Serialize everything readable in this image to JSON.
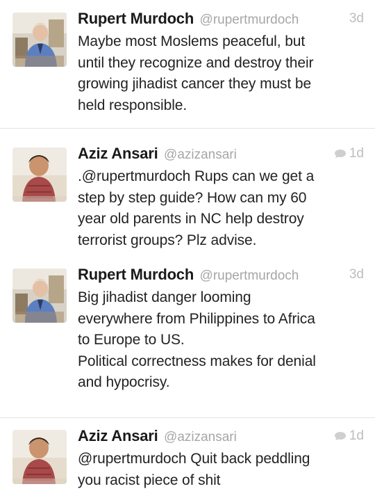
{
  "tweets": [
    {
      "name": "Rupert Murdoch",
      "handle": "@rupertmurdoch",
      "time": "3d",
      "has_reply_icon": false,
      "text": "Maybe most Moslems peaceful, but\nuntil they recognize and destroy their\ngrowing jihadist cancer they must be\nheld responsible.",
      "avatar": "rupert-murdoch-avatar"
    },
    {
      "name": "Aziz Ansari",
      "handle": "@azizansari",
      "time": "1d",
      "has_reply_icon": true,
      "text": ".@rupertmurdoch Rups can we get a\nstep by step guide? How can my 60\nyear old parents in NC help destroy\nterrorist groups? Plz advise.",
      "avatar": "aziz-ansari-avatar"
    },
    {
      "name": "Rupert Murdoch",
      "handle": "@rupertmurdoch",
      "time": "3d",
      "has_reply_icon": false,
      "text": "Big jihadist danger looming\neverywhere from Philippines to Africa\nto Europe to US.\nPolitical correctness makes for denial\nand hypocrisy.",
      "avatar": "rupert-murdoch-avatar"
    },
    {
      "name": "Aziz Ansari",
      "handle": "@azizansari",
      "time": "1d",
      "has_reply_icon": true,
      "text": "@rupertmurdoch Quit back peddling\nyou racist piece of shit",
      "avatar": "aziz-ansari-avatar"
    }
  ],
  "colors": {
    "text": "#222222",
    "handle": "#a6a6a6",
    "meta": "#bdbdbd",
    "divider": "#e3e3e3"
  }
}
